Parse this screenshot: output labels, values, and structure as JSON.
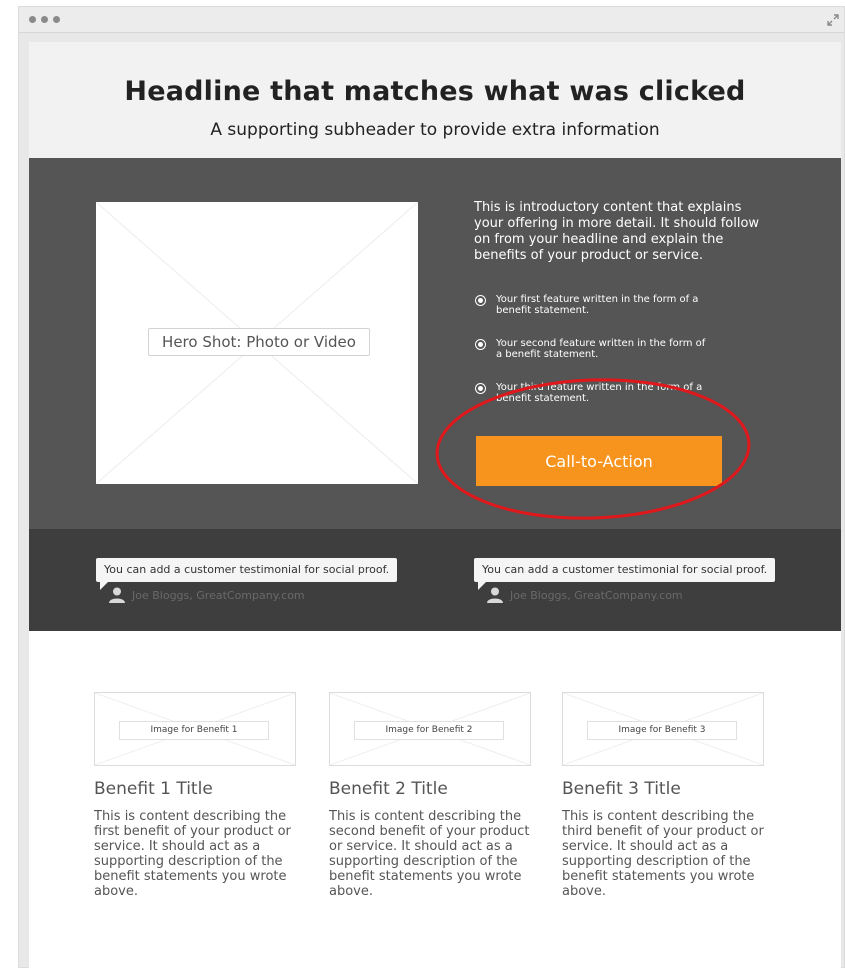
{
  "header": {
    "headline": "Headline that matches what was clicked",
    "subheader": "A supporting subheader to provide extra information"
  },
  "hero": {
    "image_label": "Hero Shot: Photo or Video",
    "intro": "This is introductory content that explains your offering in more detail. It should follow on from your headline and explain the benefits of your product or service.",
    "features": [
      "Your first feature written in the form of a benefit statement.",
      "Your second feature written in the form of a benefit statement.",
      "Your third feature written in the form of a benefit statement."
    ],
    "cta_label": "Call-to-Action"
  },
  "testimonials": [
    {
      "quote": "You can add a customer testimonial for social proof.",
      "author": "Joe Bloggs, GreatCompany.com"
    },
    {
      "quote": "You can add a customer testimonial for social proof.",
      "author": "Joe Bloggs, GreatCompany.com"
    }
  ],
  "benefits": [
    {
      "image_label": "Image for Benefit 1",
      "title": "Benefit 1 Title",
      "text": "This is content describing the first benefit of your product or service. It should act as a supporting description of the benefit statements you wrote above."
    },
    {
      "image_label": "Image for Benefit 2",
      "title": "Benefit 2 Title",
      "text": "This is content describing the second benefit of your product or service. It should act as a supporting description of the benefit statements you wrote above."
    },
    {
      "image_label": "Image for Benefit 3",
      "title": "Benefit 3 Title",
      "text": "This is content describing the third benefit of your product or service. It should act as a supporting description of the benefit statements you wrote above."
    }
  ],
  "colors": {
    "cta": "#f7941d",
    "hero_bg": "#555556",
    "testimonial_bg": "#3e3e3f",
    "highlight": "#e0181b"
  },
  "icons": [
    "window-dot-icon",
    "expand-icon",
    "radio-selected-icon",
    "person-icon"
  ]
}
